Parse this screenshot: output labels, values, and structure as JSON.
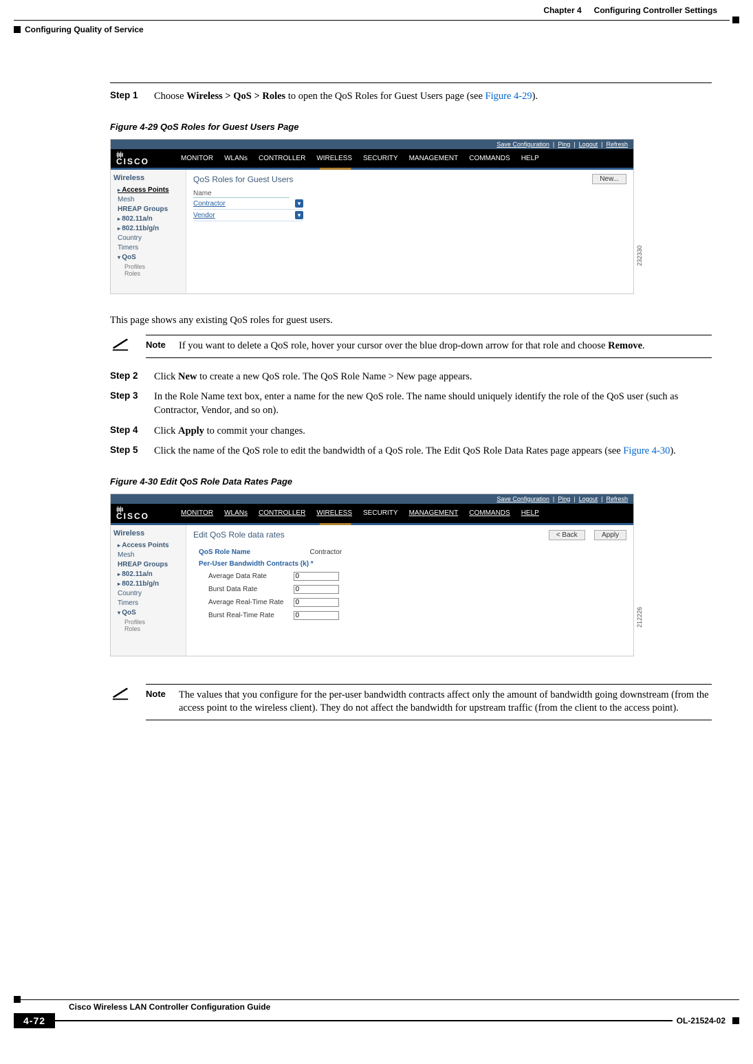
{
  "header": {
    "chapter_label": "Chapter 4",
    "chapter_title": "Configuring Controller Settings",
    "section_title": "Configuring Quality of Service"
  },
  "steps": {
    "s1_label": "Step 1",
    "s1_pre": "Choose ",
    "s1_bold": "Wireless > QoS > Roles",
    "s1_mid": " to open the QoS Roles for Guest Users page (see ",
    "s1_link": "Figure 4-29",
    "s1_post": ").",
    "fig1_caption": "Figure 4-29   QoS Roles for Guest Users Page",
    "after_fig1": "This page shows any existing QoS roles for guest users.",
    "note1": "If you want to delete a QoS role, hover your cursor over the blue drop-down arrow for that role and choose ",
    "note1_bold": "Remove",
    "note1_post": ".",
    "s2_label": "Step 2",
    "s2_pre": "Click ",
    "s2_bold": "New",
    "s2_post": " to create a new QoS role. The QoS Role Name > New page appears.",
    "s3_label": "Step 3",
    "s3_text": "In the Role Name text box, enter a name for the new QoS role. The name should uniquely identify the role of the QoS user (such as Contractor, Vendor, and so on).",
    "s4_label": "Step 4",
    "s4_pre": "Click ",
    "s4_bold": "Apply",
    "s4_post": " to commit your changes.",
    "s5_label": "Step 5",
    "s5_pre": "Click the name of the QoS role to edit the bandwidth of a QoS role. The Edit QoS Role Data Rates page appears (see ",
    "s5_link": "Figure 4-30",
    "s5_post": ").",
    "fig2_caption": "Figure 4-30   Edit QoS Role Data Rates Page",
    "note2": "The values that you configure for the per-user bandwidth contracts affect only the amount of bandwidth going downstream (from the access point to the wireless client). They do not affect the bandwidth for upstream traffic (from the client to the access point)."
  },
  "note_label": "Note",
  "gui1": {
    "topbar_save": "Save Configuration",
    "topbar_ping": "Ping",
    "topbar_logout": "Logout",
    "topbar_refresh": "Refresh",
    "brand": "CISCO",
    "nav": [
      "MONITOR",
      "WLANs",
      "CONTROLLER",
      "WIRELESS",
      "SECURITY",
      "MANAGEMENT",
      "COMMANDS",
      "HELP"
    ],
    "side_title": "Wireless",
    "side_items": {
      "access_points": "Access Points",
      "mesh": "Mesh",
      "hreap": "HREAP Groups",
      "n80211a": "802.11a/n",
      "n80211b": "802.11b/g/n",
      "country": "Country",
      "timers": "Timers",
      "qos": "QoS",
      "profiles": "Profiles",
      "roles": "Roles"
    },
    "main_title": "QoS Roles for Guest Users",
    "btn_new": "New...",
    "col_name": "Name",
    "row1": "Contractor",
    "row2": "Vendor",
    "figno": "232330"
  },
  "gui2": {
    "main_title": "Edit QoS Role data rates",
    "btn_back": "< Back",
    "btn_apply": "Apply",
    "role_label": "QoS Role Name",
    "role_value": "Contractor",
    "contracts_label": "Per-User Bandwidth Contracts (k) *",
    "fields": {
      "avg_data": "Average Data Rate",
      "burst_data": "Burst Data Rate",
      "avg_rt": "Average Real-Time Rate",
      "burst_rt": "Burst Real-Time Rate"
    },
    "val": "0",
    "figno": "212226"
  },
  "footer": {
    "guide_title": "Cisco Wireless LAN Controller Configuration Guide",
    "page_number": "4-72",
    "doc_id": "OL-21524-02"
  }
}
